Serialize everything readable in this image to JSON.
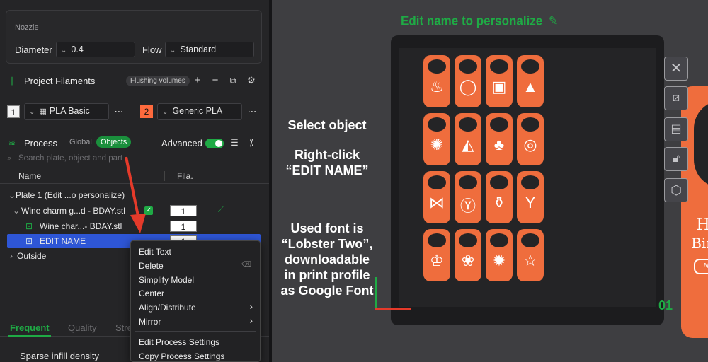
{
  "nozzle": {
    "title": "Nozzle",
    "diameter_label": "Diameter",
    "diameter_value": "0.4",
    "flow_label": "Flow",
    "flow_value": "Standard"
  },
  "filaments": {
    "title": "Project Filaments",
    "flushing_label": "Flushing volumes",
    "items": [
      {
        "index": "1",
        "name": "PLA Basic",
        "color": "#f4f4f4"
      },
      {
        "index": "2",
        "name": "Generic PLA",
        "color": "#ff6a3d"
      }
    ]
  },
  "process": {
    "title": "Process",
    "tab_global": "Global",
    "tab_objects": "Objects",
    "advanced_label": "Advanced",
    "advanced_on": true
  },
  "search": {
    "placeholder": "Search plate, object and part"
  },
  "tree": {
    "col_name": "Name",
    "col_fila": "Fila.",
    "rows": [
      {
        "label": "Plate 1 (Edit ...o personalize)",
        "fila": ""
      },
      {
        "label": "Wine charm g...d - BDAY.stl",
        "fila": "1"
      },
      {
        "label": "Wine char...- BDAY.stl",
        "fila": "1"
      },
      {
        "label": "EDIT NAME",
        "fila": "1"
      },
      {
        "label": "Outside",
        "fila": ""
      }
    ]
  },
  "context_menu": {
    "items": [
      "Edit Text",
      "Delete",
      "Simplify Model",
      "Center",
      "Align/Distribute",
      "Mirror",
      "Edit Process Settings",
      "Copy Process Settings"
    ]
  },
  "bottom": {
    "tabs": [
      "Frequent",
      "Quality",
      "Stre"
    ],
    "setting_label": "Sparse infill density"
  },
  "viewport": {
    "edit_title": "Edit name to personalize",
    "instruction1": "Select object",
    "instruction2_line1": "Right-click",
    "instruction2_line2": "“EDIT NAME”",
    "font_note_line1": "Used font is",
    "font_note_line2": "“Lobster Two”,",
    "font_note_line3": "downloadable",
    "font_note_line4": "in print profile",
    "font_note_line5": "as Google Font",
    "plate_number": "01",
    "happy": "Happy",
    "birthday": "Birthday",
    "name_tag": "Nicastname"
  },
  "colors": {
    "accent_green": "#1faa45",
    "model_orange": "#ef6d3d",
    "arrow_red": "#e53a2a",
    "selection_blue": "#2e56d6"
  }
}
